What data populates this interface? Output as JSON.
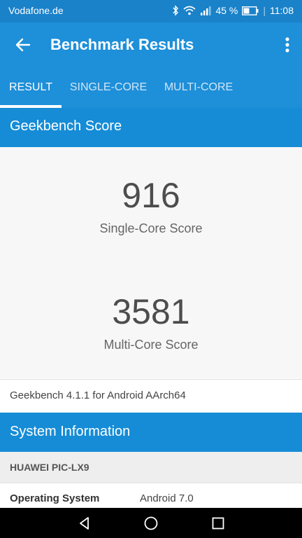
{
  "status_bar": {
    "carrier": "Vodafone.de",
    "battery": "45 %",
    "time": "11:08"
  },
  "app_bar": {
    "title": "Benchmark Results",
    "back_icon": "arrow-left-icon",
    "menu_icon": "more-vert-icon"
  },
  "tabs": [
    {
      "label": "RESULT",
      "active": true
    },
    {
      "label": "SINGLE-CORE",
      "active": false
    },
    {
      "label": "MULTI-CORE",
      "active": false
    }
  ],
  "geekbench_score": {
    "header": "Geekbench Score",
    "single_core_value": "916",
    "single_core_label": "Single-Core Score",
    "multi_core_value": "3581",
    "multi_core_label": "Multi-Core Score",
    "version": "Geekbench 4.1.1 for Android AArch64"
  },
  "system_information": {
    "header": "System Information",
    "device": "HUAWEI PIC-LX9",
    "rows": [
      {
        "key": "Operating System",
        "value": "Android 7.0"
      }
    ]
  },
  "colors": {
    "app_bar": "#1e8fd9",
    "status_bar": "#1a82c9",
    "score_text": "#4d4d4d"
  }
}
